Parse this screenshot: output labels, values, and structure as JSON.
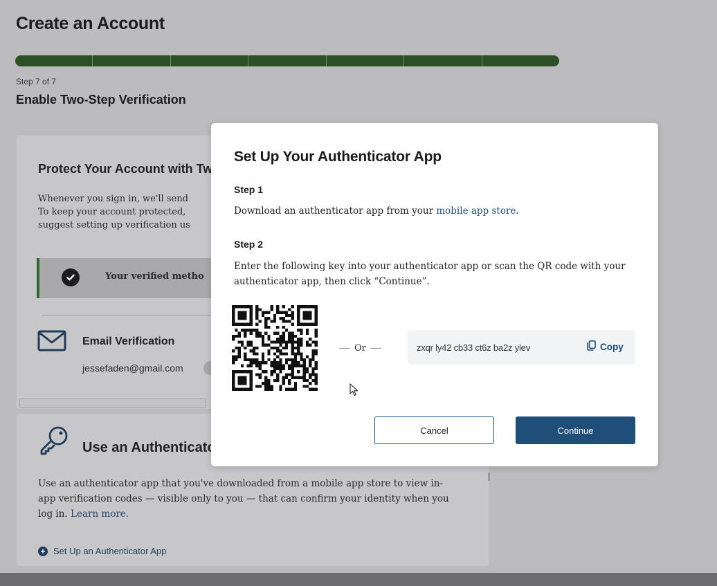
{
  "page": {
    "title": "Create an Account",
    "progress": {
      "current_step": 7,
      "total_steps": 7
    },
    "step_label": "Step 7 of 7",
    "step_title": "Enable Two-Step Verification"
  },
  "protect_card": {
    "title": "Protect Your Account with Tw",
    "text_lines": [
      "Whenever you sign in, we'll send",
      "To keep your account protected,",
      "suggest setting up verification us"
    ],
    "verified_text": "Your verified metho",
    "email": {
      "title": "Email Verification",
      "address": "jessefaden@gmail.com",
      "icon": "envelope-icon"
    }
  },
  "auth_card": {
    "title": "Use an Authenticator",
    "icon": "key-icon",
    "description": "Use an authenticator app that you've downloaded from a mobile app store to view in-app verification codes — visible only to you — that can confirm your identity when you log in.",
    "learn_more": "Learn more.",
    "setup_link": "Set Up an Authenticator App"
  },
  "modal": {
    "title": "Set Up Your Authenticator App",
    "step1_label": "Step 1",
    "step1_text_before": "Download an authenticator app from your ",
    "step1_link": "mobile app store",
    "step1_text_after": ".",
    "step2_label": "Step 2",
    "step2_text": "Enter the following key into your authenticator app or scan the QR code with your authenticator app, then click “Continue”.",
    "or_label": "Or",
    "key": "zxqr ly42 cb33 ct6z ba2z ylev",
    "copy_label": "Copy",
    "cancel_label": "Cancel",
    "continue_label": "Continue"
  },
  "colors": {
    "progress_fill": "#2c4f26",
    "primary": "#1f4e79",
    "verified_accent": "#2c6a2f"
  }
}
